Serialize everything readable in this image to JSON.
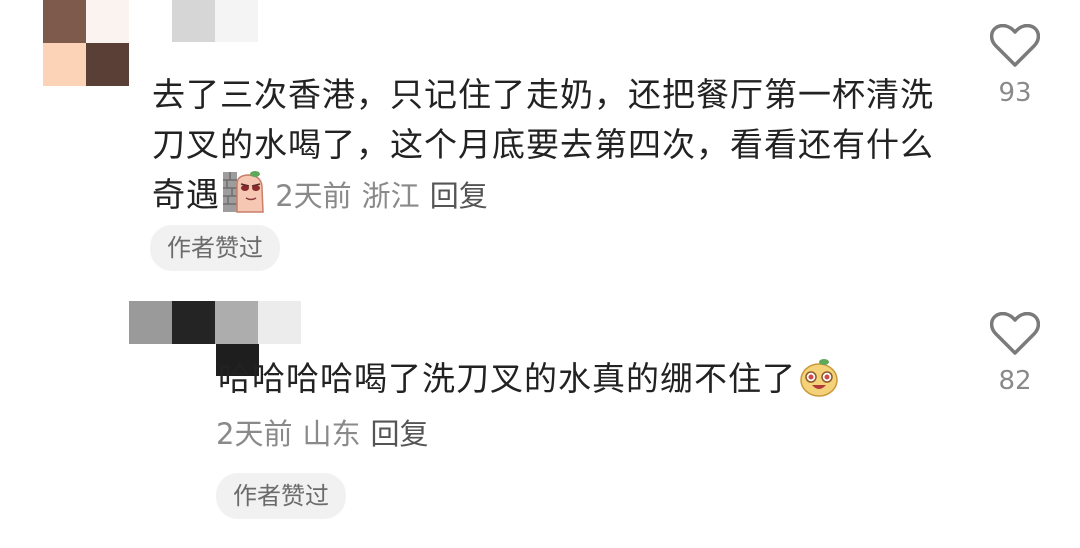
{
  "comments": [
    {
      "text": "去了三次香港，只记住了走奶，还把餐厅第一杯清洗刀叉的水喝了，这个月底要去第四次，看看还有什么奇遇",
      "emoji": "wall-peek-emoji",
      "time": "2天前",
      "location": "浙江",
      "reply_label": "回复",
      "badge": "作者赞过",
      "like_icon": "heart-outline-icon",
      "likes": "93"
    },
    {
      "text": "哈哈哈哈喝了洗刀叉的水真的绷不住了",
      "emoji": "laughing-potato-emoji",
      "time": "2天前",
      "location": "山东",
      "reply_label": "回复",
      "badge": "作者赞过",
      "like_icon": "heart-outline-icon",
      "likes": "82"
    }
  ],
  "colors": {
    "text": "#222222",
    "meta": "#8a8a8a",
    "badge_bg": "#f1f1f1",
    "heart": "#7a7a7a",
    "avatar1_tiles": [
      "#7d5a4b",
      "#fbf3f0",
      "#fcd3b6",
      "#5a3f36"
    ],
    "name1_tiles": [
      "#d6d6d6",
      "#f4f4f4"
    ],
    "name2_tiles": [
      "#9a9a9a",
      "#242424",
      "#adadad",
      "#ececec"
    ],
    "name2b_tile": "#1e1e1e"
  }
}
